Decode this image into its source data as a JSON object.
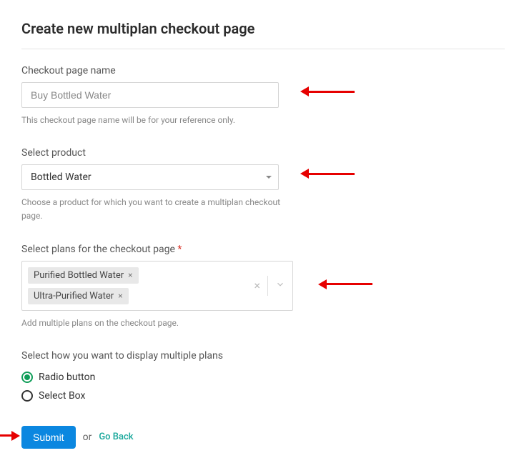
{
  "page_title": "Create new multiplan checkout page",
  "checkout_name": {
    "label": "Checkout page name",
    "value": "Buy Bottled Water",
    "help": "This checkout page name will be for your reference only."
  },
  "product": {
    "label": "Select product",
    "selected": "Bottled Water",
    "help": "Choose a product for which you want to create a multiplan checkout page."
  },
  "plans": {
    "label": "Select plans for the checkout page",
    "chips": [
      {
        "label": "Purified Bottled Water"
      },
      {
        "label": "Ultra-Purified Water"
      }
    ],
    "help": "Add multiple plans on the checkout page."
  },
  "display": {
    "label": "Select how you want to display multiple plans",
    "options": [
      {
        "label": "Radio button",
        "checked": true
      },
      {
        "label": "Select Box",
        "checked": false
      }
    ]
  },
  "actions": {
    "submit": "Submit",
    "or": "or",
    "go_back": "Go Back"
  }
}
